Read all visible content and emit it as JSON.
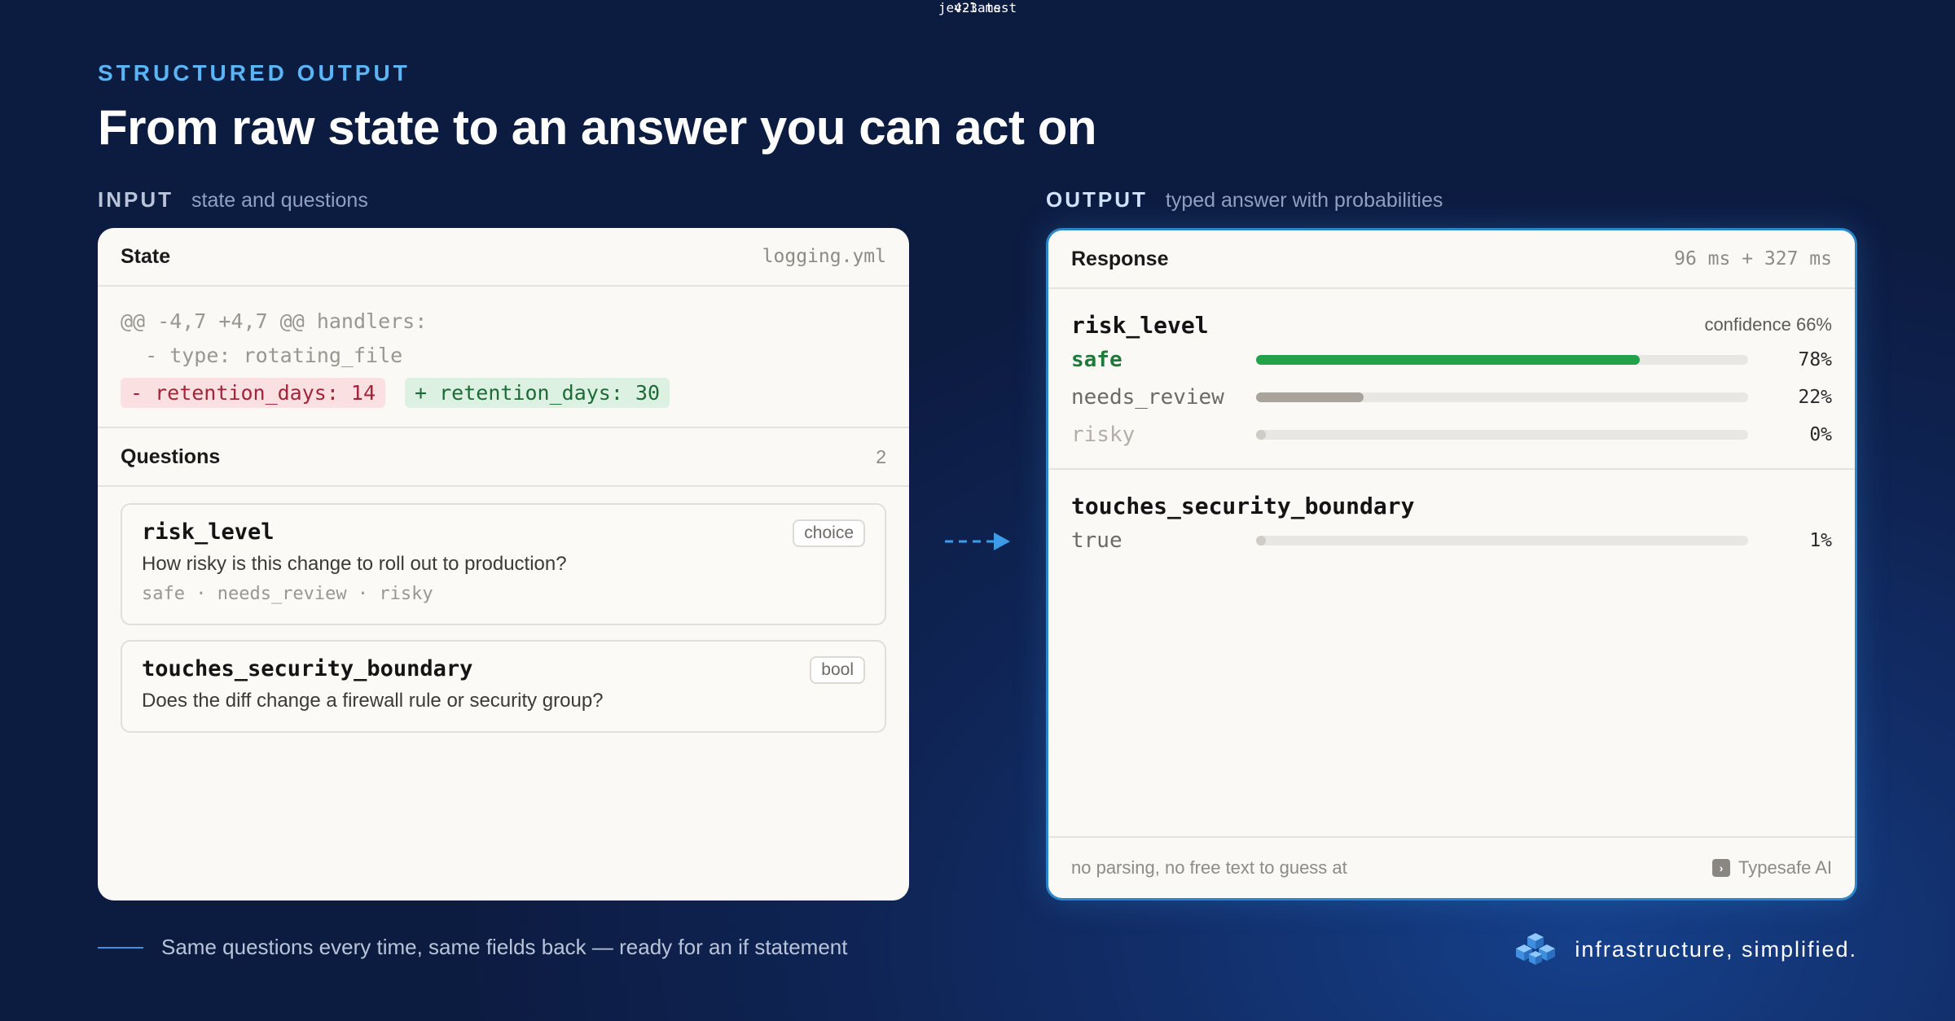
{
  "header": {
    "eyebrow": "STRUCTURED OUTPUT",
    "title": "From raw state to an answer you can act on"
  },
  "input": {
    "label": "INPUT",
    "description": "state and questions",
    "state": {
      "title": "State",
      "filename": "logging.yml",
      "diff_hunk": "@@ -4,7 +4,7 @@ handlers:",
      "diff_context": "  - type: rotating_file",
      "diff_removed": "- retention_days: 14",
      "diff_added": "+ retention_days: 30"
    },
    "questions": {
      "title": "Questions",
      "count": "2",
      "items": [
        {
          "name": "risk_level",
          "text": "How risky is this change to roll out to production?",
          "options": "safe · needs_review · risky",
          "type": "choice"
        },
        {
          "name": "touches_security_boundary",
          "text": "Does the diff change a firewall rule or security group?",
          "type": "bool"
        }
      ]
    }
  },
  "middle": {
    "latency": "423 ms",
    "model": "jev-latest"
  },
  "output": {
    "label": "OUTPUT",
    "description": "typed answer with probabilities",
    "response": {
      "title": "Response",
      "timing": "96 ms + 327 ms",
      "fields": [
        {
          "name": "risk_level",
          "confidence": "confidence 66%",
          "options": [
            {
              "label": "safe",
              "pct": "78%",
              "value": 0.78,
              "color": "#22a34a",
              "text_color": "#1f7a3a"
            },
            {
              "label": "needs_review",
              "pct": "22%",
              "value": 0.22,
              "color": "#a8a49c",
              "text_color": "#6d6a65"
            },
            {
              "label": "risky",
              "pct": "0%",
              "value": 0.0,
              "color": "#cfccc6",
              "text_color": "#b3afa8"
            }
          ]
        },
        {
          "name": "touches_security_boundary",
          "options": [
            {
              "label": "true",
              "pct": "1%",
              "value": 0.01,
              "color": "#cfccc6",
              "text_color": "#6d6a65"
            }
          ]
        }
      ],
      "footer_note": "no parsing, no free text to guess at",
      "brand": "Typesafe AI"
    }
  },
  "footer": {
    "caption": "Same questions every time, same fields back — ready for an if statement",
    "tagline": "infrastructure, simplified."
  },
  "colors": {
    "accent": "#5ab4f5",
    "output_border": "#2a86c9"
  }
}
